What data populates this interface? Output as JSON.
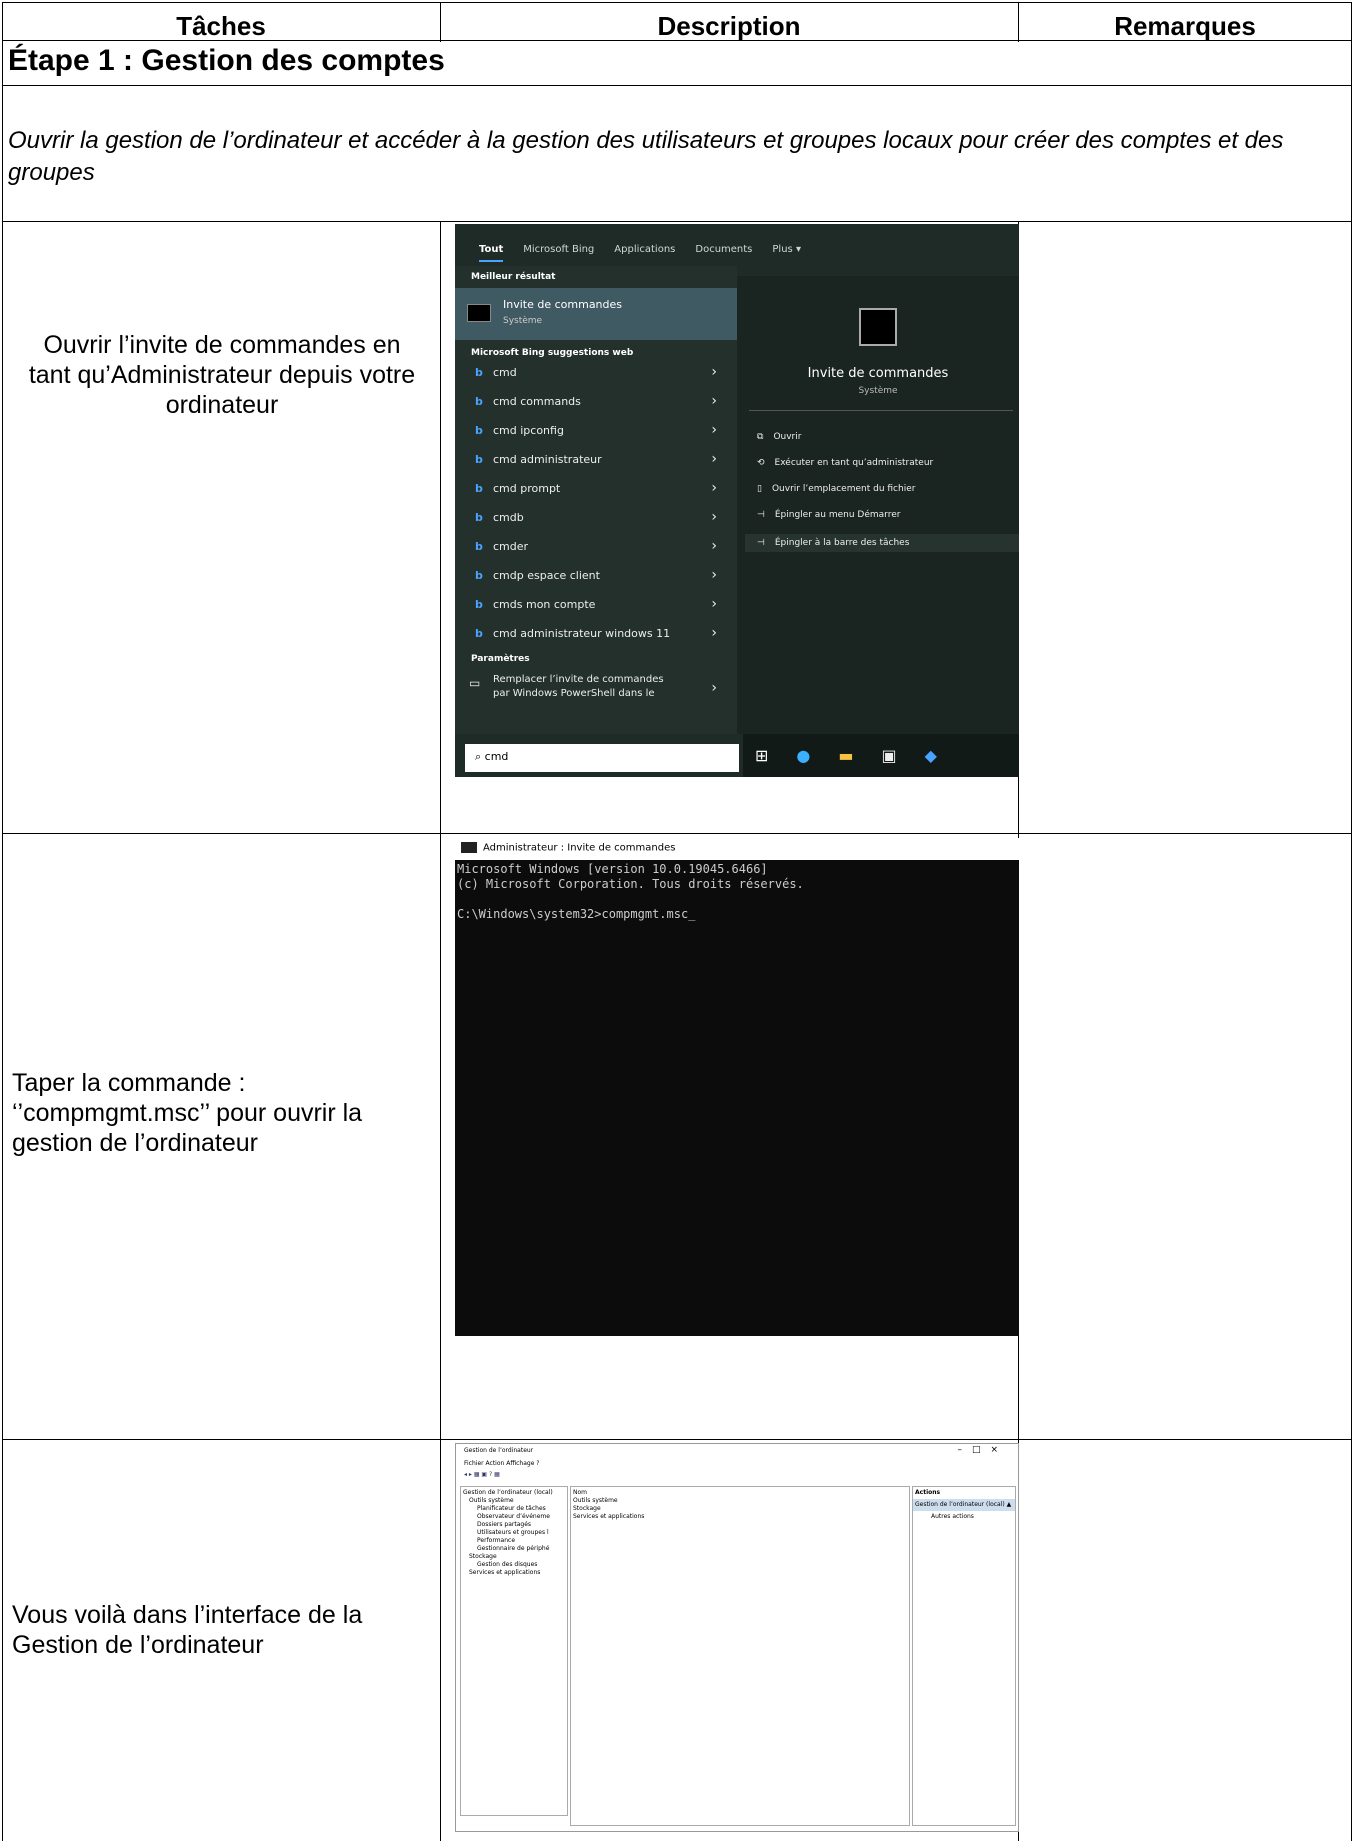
{
  "table": {
    "headers": [
      "Tâches",
      "Description",
      "Remarques"
    ],
    "step_title": "Étape 1 : Gestion des comptes",
    "intro": "Ouvrir la gestion de l’ordinateur et accéder à la gestion des utilisateurs et groupes locaux pour créer des comptes et des groupes",
    "rows": [
      {
        "task": "Ouvrir l’invite de commandes en tant qu’Administrateur depuis votre ordinateur",
        "remark": ""
      },
      {
        "task": "Taper la commande : ‘’compmgmt.msc’’ pour ouvrir la gestion de l’ordinateur",
        "remark": ""
      },
      {
        "task": "Vous voilà dans l’interface de la Gestion de l’ordinateur",
        "remark": ""
      }
    ]
  },
  "start_menu": {
    "tabs": [
      "Tout",
      "Microsoft Bing",
      "Applications",
      "Documents",
      "Plus ▾"
    ],
    "best_label": "Meilleur résultat",
    "best_title": "Invite de commandes",
    "best_sub": "Système",
    "bing_label": "Microsoft Bing suggestions web",
    "suggestions": [
      "cmd",
      "cmd commands",
      "cmd ipconfig",
      "cmd administrateur",
      "cmd prompt",
      "cmdb",
      "cmder",
      "cmdp espace client",
      "cmds mon compte",
      "cmd administrateur windows 11"
    ],
    "params_label": "Paramètres",
    "param_item_1": "Remplacer l’invite de commandes",
    "param_item_2": "par Windows PowerShell dans le",
    "preview_title": "Invite de commandes",
    "preview_sub": "Système",
    "actions": [
      "Ouvrir",
      "Exécuter en tant qu’administrateur",
      "Ouvrir l’emplacement du fichier",
      "Épingler au menu Démarrer",
      "Épingler à la barre des tâches"
    ],
    "search_value": "cmd"
  },
  "cmd_window": {
    "title": "Administrateur : Invite de commandes",
    "lines": "Microsoft Windows [version 10.0.19045.6466]\n(c) Microsoft Corporation. Tous droits réservés.\n\nC:\\Windows\\system32>compmgmt.msc_"
  },
  "mgmt_window": {
    "title": "Gestion de l’ordinateur",
    "menu": "Fichier   Action   Affichage   ?",
    "tree": [
      "Gestion de l’ordinateur (local)",
      "Outils système",
      "Planificateur de tâches",
      "Observateur d’événeme",
      "Dossiers partagés",
      "Utilisateurs et groupes l",
      "Performance",
      "Gestionnaire de périphé",
      "Stockage",
      "Gestion des disques",
      "Services et applications"
    ],
    "list_header": "Nom",
    "list": [
      "Outils système",
      "Stockage",
      "Services et applications"
    ],
    "actions_header": "Actions",
    "actions_selected": "Gestion de l’ordinateur (local) ▲",
    "actions_other": "Autres actions"
  }
}
